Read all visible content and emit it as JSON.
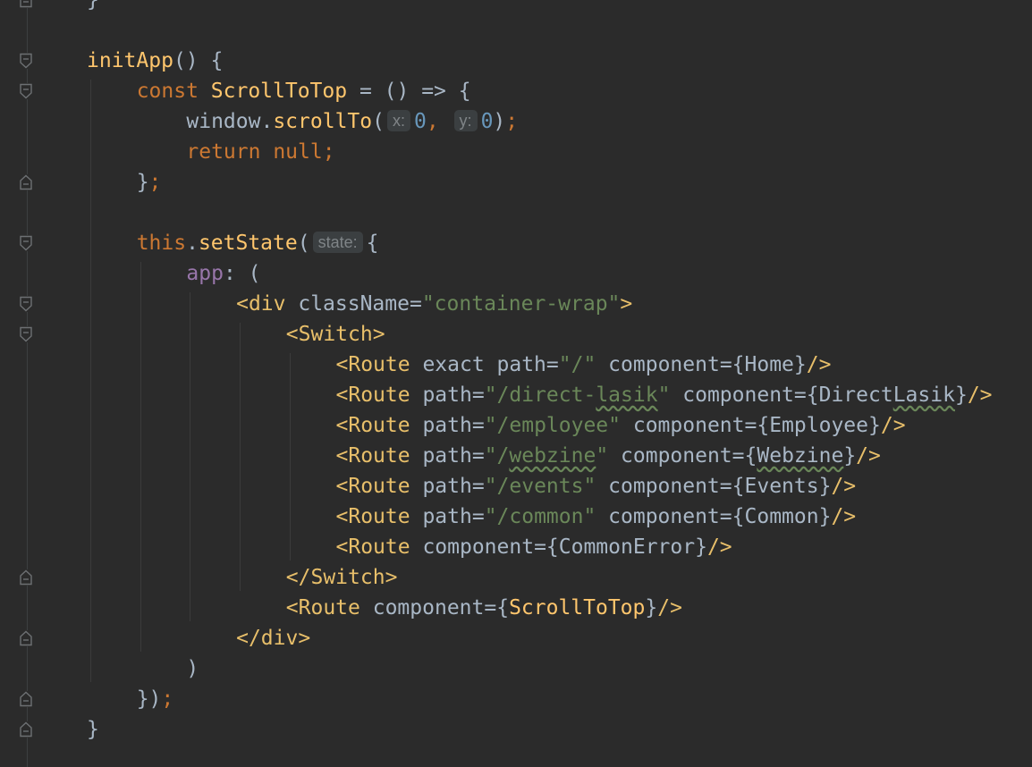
{
  "editor": {
    "lines": [
      {
        "indent": 0,
        "tokens": [
          {
            "t": "}",
            "c": "punc"
          }
        ]
      },
      {
        "indent": 0,
        "tokens": []
      },
      {
        "indent": 0,
        "tokens": [
          {
            "t": "initApp",
            "c": "fn"
          },
          {
            "t": "() {",
            "c": "punc"
          }
        ]
      },
      {
        "indent": 1,
        "tokens": [
          {
            "t": "const ",
            "c": "kw"
          },
          {
            "t": "ScrollToTop",
            "c": "fn"
          },
          {
            "t": " = () => {",
            "c": "punc"
          }
        ]
      },
      {
        "indent": 2,
        "tokens": [
          {
            "t": "window.",
            "c": "punc"
          },
          {
            "t": "scrollTo",
            "c": "fn"
          },
          {
            "t": "(",
            "c": "punc"
          },
          {
            "hint": "x:"
          },
          {
            "t": "0",
            "c": "num"
          },
          {
            "t": ", ",
            "c": "semi"
          },
          {
            "hint": "y:"
          },
          {
            "t": "0",
            "c": "num"
          },
          {
            "t": ")",
            "c": "punc"
          },
          {
            "t": ";",
            "c": "semi"
          }
        ]
      },
      {
        "indent": 2,
        "tokens": [
          {
            "t": "return ",
            "c": "kw"
          },
          {
            "t": "null",
            "c": "kw"
          },
          {
            "t": ";",
            "c": "semi"
          }
        ]
      },
      {
        "indent": 1,
        "tokens": [
          {
            "t": "}",
            "c": "punc"
          },
          {
            "t": ";",
            "c": "semi"
          }
        ]
      },
      {
        "indent": 0,
        "tokens": []
      },
      {
        "indent": 1,
        "tokens": [
          {
            "t": "this",
            "c": "kw"
          },
          {
            "t": ".",
            "c": "punc"
          },
          {
            "t": "setState",
            "c": "fn"
          },
          {
            "t": "(",
            "c": "punc"
          },
          {
            "hint": "state:"
          },
          {
            "t": "{",
            "c": "punc"
          }
        ]
      },
      {
        "indent": 2,
        "tokens": [
          {
            "t": "app",
            "c": "prop"
          },
          {
            "t": ": (",
            "c": "punc"
          }
        ]
      },
      {
        "indent": 3,
        "tokens": [
          {
            "t": "<div ",
            "c": "tag"
          },
          {
            "t": "className",
            "c": "attr"
          },
          {
            "t": "=",
            "c": "punc"
          },
          {
            "t": "\"container-wrap\"",
            "c": "str"
          },
          {
            "t": ">",
            "c": "tag"
          }
        ]
      },
      {
        "indent": 4,
        "tokens": [
          {
            "t": "<Switch>",
            "c": "tag"
          }
        ]
      },
      {
        "indent": 5,
        "tokens": [
          {
            "t": "<Route ",
            "c": "tag"
          },
          {
            "t": "exact path",
            "c": "attr"
          },
          {
            "t": "=",
            "c": "punc"
          },
          {
            "t": "\"/\"",
            "c": "str"
          },
          {
            "t": " component",
            "c": "attr"
          },
          {
            "t": "={",
            "c": "punc"
          },
          {
            "t": "Home",
            "c": "attr"
          },
          {
            "t": "}",
            "c": "punc"
          },
          {
            "t": "/>",
            "c": "tag"
          }
        ]
      },
      {
        "indent": 5,
        "tokens": [
          {
            "t": "<Route ",
            "c": "tag"
          },
          {
            "t": "path",
            "c": "attr"
          },
          {
            "t": "=",
            "c": "punc"
          },
          {
            "t": "\"/direct-",
            "c": "str"
          },
          {
            "t": "lasik",
            "c": "str",
            "sq": true
          },
          {
            "t": "\"",
            "c": "str"
          },
          {
            "t": " component",
            "c": "attr"
          },
          {
            "t": "={",
            "c": "punc"
          },
          {
            "t": "Direct",
            "c": "attr"
          },
          {
            "t": "Lasik",
            "c": "attr",
            "sq": true
          },
          {
            "t": "}",
            "c": "punc"
          },
          {
            "t": "/>",
            "c": "tag"
          }
        ]
      },
      {
        "indent": 5,
        "tokens": [
          {
            "t": "<Route ",
            "c": "tag"
          },
          {
            "t": "path",
            "c": "attr"
          },
          {
            "t": "=",
            "c": "punc"
          },
          {
            "t": "\"/employee\"",
            "c": "str"
          },
          {
            "t": " component",
            "c": "attr"
          },
          {
            "t": "={",
            "c": "punc"
          },
          {
            "t": "Employee",
            "c": "attr"
          },
          {
            "t": "}",
            "c": "punc"
          },
          {
            "t": "/>",
            "c": "tag"
          }
        ]
      },
      {
        "indent": 5,
        "tokens": [
          {
            "t": "<Route ",
            "c": "tag"
          },
          {
            "t": "path",
            "c": "attr"
          },
          {
            "t": "=",
            "c": "punc"
          },
          {
            "t": "\"/",
            "c": "str"
          },
          {
            "t": "webzine",
            "c": "str",
            "sq": true
          },
          {
            "t": "\"",
            "c": "str"
          },
          {
            "t": " component",
            "c": "attr"
          },
          {
            "t": "={",
            "c": "punc"
          },
          {
            "t": "Webzine",
            "c": "attr",
            "sq": true
          },
          {
            "t": "}",
            "c": "punc"
          },
          {
            "t": "/>",
            "c": "tag"
          }
        ]
      },
      {
        "indent": 5,
        "tokens": [
          {
            "t": "<Route ",
            "c": "tag"
          },
          {
            "t": "path",
            "c": "attr"
          },
          {
            "t": "=",
            "c": "punc"
          },
          {
            "t": "\"/events\"",
            "c": "str"
          },
          {
            "t": " component",
            "c": "attr"
          },
          {
            "t": "={",
            "c": "punc"
          },
          {
            "t": "Events",
            "c": "attr"
          },
          {
            "t": "}",
            "c": "punc"
          },
          {
            "t": "/>",
            "c": "tag"
          }
        ]
      },
      {
        "indent": 5,
        "tokens": [
          {
            "t": "<Route ",
            "c": "tag"
          },
          {
            "t": "path",
            "c": "attr"
          },
          {
            "t": "=",
            "c": "punc"
          },
          {
            "t": "\"/common\"",
            "c": "str"
          },
          {
            "t": " component",
            "c": "attr"
          },
          {
            "t": "={",
            "c": "punc"
          },
          {
            "t": "Common",
            "c": "attr"
          },
          {
            "t": "}",
            "c": "punc"
          },
          {
            "t": "/>",
            "c": "tag"
          }
        ]
      },
      {
        "indent": 5,
        "tokens": [
          {
            "t": "<Route ",
            "c": "tag"
          },
          {
            "t": "component",
            "c": "attr"
          },
          {
            "t": "={",
            "c": "punc"
          },
          {
            "t": "CommonError",
            "c": "attr"
          },
          {
            "t": "}",
            "c": "punc"
          },
          {
            "t": "/>",
            "c": "tag"
          }
        ]
      },
      {
        "indent": 4,
        "tokens": [
          {
            "t": "</Switch>",
            "c": "tag"
          }
        ]
      },
      {
        "indent": 4,
        "tokens": [
          {
            "t": "<Route ",
            "c": "tag"
          },
          {
            "t": "component",
            "c": "attr"
          },
          {
            "t": "={",
            "c": "punc"
          },
          {
            "t": "ScrollToTop",
            "c": "fn"
          },
          {
            "t": "}",
            "c": "punc"
          },
          {
            "t": "/>",
            "c": "tag"
          }
        ]
      },
      {
        "indent": 3,
        "tokens": [
          {
            "t": "</div>",
            "c": "tag"
          }
        ]
      },
      {
        "indent": 2,
        "tokens": [
          {
            "t": ")",
            "c": "punc"
          }
        ]
      },
      {
        "indent": 1,
        "tokens": [
          {
            "t": "})",
            "c": "punc"
          },
          {
            "t": ";",
            "c": "semi"
          }
        ]
      },
      {
        "indent": 0,
        "tokens": [
          {
            "t": "}",
            "c": "punc"
          }
        ]
      }
    ],
    "folds": [
      {
        "line": 0,
        "type": "end"
      },
      {
        "line": 2,
        "type": "start"
      },
      {
        "line": 3,
        "type": "start"
      },
      {
        "line": 6,
        "type": "end"
      },
      {
        "line": 8,
        "type": "start"
      },
      {
        "line": 10,
        "type": "start"
      },
      {
        "line": 11,
        "type": "start"
      },
      {
        "line": 19,
        "type": "end"
      },
      {
        "line": 21,
        "type": "end"
      },
      {
        "line": 23,
        "type": "end"
      },
      {
        "line": 24,
        "type": "end"
      }
    ]
  },
  "colors": {
    "background": "#2b2b2b",
    "keyword": "#cc7832",
    "function": "#ffc66d",
    "string": "#6a8759",
    "number": "#6897bb",
    "property": "#9876aa",
    "tag": "#e8bf6a",
    "text": "#a9b7c6",
    "hint_bg": "#3b3f41",
    "hint_text": "#7f8487"
  }
}
